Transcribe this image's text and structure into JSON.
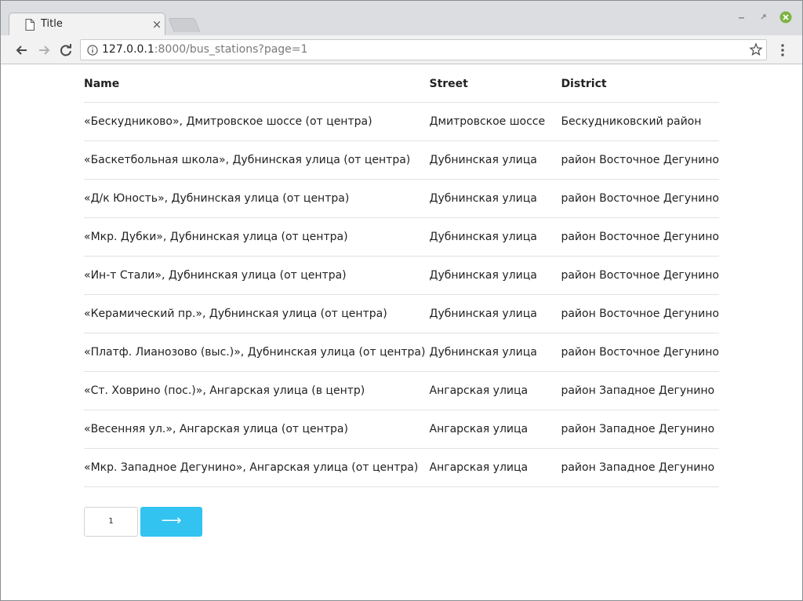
{
  "browser": {
    "tab_title": "Title",
    "tab_close": "×",
    "url_host": "127.0.0.1",
    "url_rest": ":8000/bus_stations?page=1",
    "accent_close": "#7cb342"
  },
  "table": {
    "headers": [
      "Name",
      "Street",
      "District"
    ],
    "rows": [
      {
        "name": "«Бескудниково», Дмитровское шоссе (от центра)",
        "street": "Дмитровское шоссе",
        "district": "Бескудниковский район"
      },
      {
        "name": "«Баскетбольная школа», Дубнинская улица (от центра)",
        "street": "Дубнинская улица",
        "district": "район Восточное Дегунино"
      },
      {
        "name": "«Д/к Юность», Дубнинская улица (от центра)",
        "street": "Дубнинская улица",
        "district": "район Восточное Дегунино"
      },
      {
        "name": "«Мкр. Дубки», Дубнинская улица (от центра)",
        "street": "Дубнинская улица",
        "district": "район Восточное Дегунино"
      },
      {
        "name": "«Ин-т Стали», Дубнинская улица (от центра)",
        "street": "Дубнинская улица",
        "district": "район Восточное Дегунино"
      },
      {
        "name": "«Керамический пр.», Дубнинская улица (от центра)",
        "street": "Дубнинская улица",
        "district": "район Восточное Дегунино"
      },
      {
        "name": "«Платф. Лианозово (выс.)», Дубнинская улица (от центра)",
        "street": "Дубнинская улица",
        "district": "район Восточное Дегунино"
      },
      {
        "name": "«Ст. Ховрино (пос.)», Ангарская улица (в центр)",
        "street": "Ангарская улица",
        "district": "район Западное Дегунино"
      },
      {
        "name": "«Весенняя ул.», Ангарская улица (от центра)",
        "street": "Ангарская улица",
        "district": "район Западное Дегунино"
      },
      {
        "name": "«Мкр. Западное Дегунино», Ангарская улица (от центра)",
        "street": "Ангарская улица",
        "district": "район Западное Дегунино"
      }
    ]
  },
  "pagination": {
    "current_page": "1",
    "next_label": "⟶",
    "accent": "#33c3f0"
  }
}
